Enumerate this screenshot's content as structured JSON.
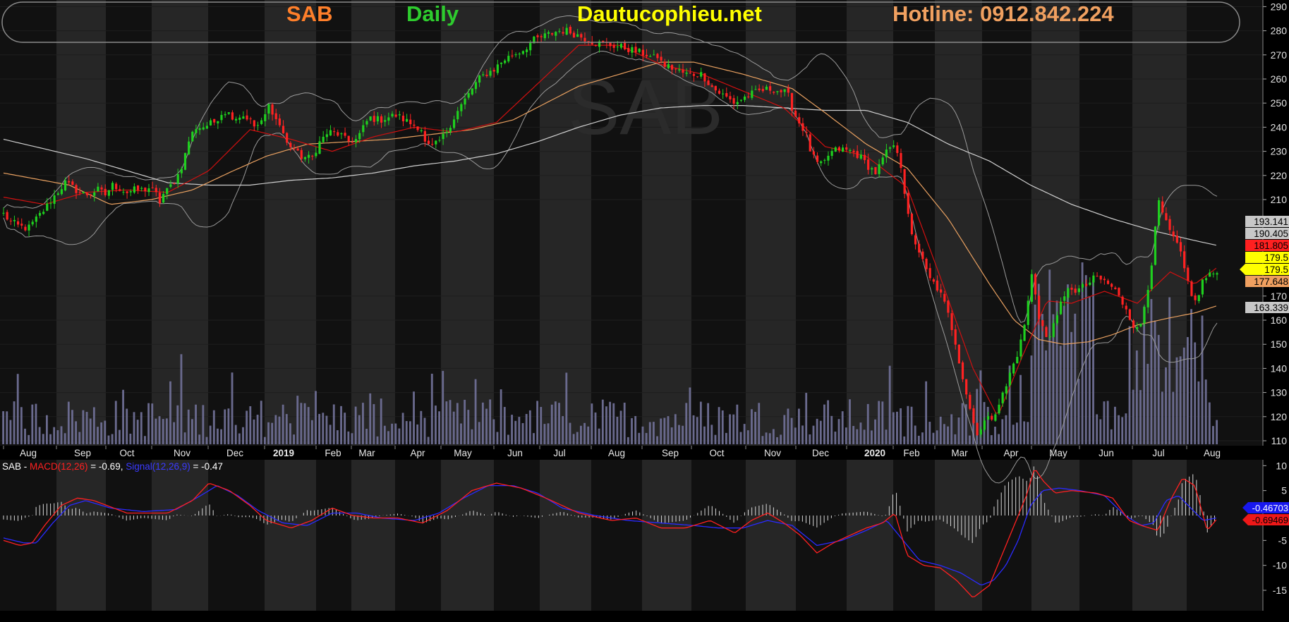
{
  "header": {
    "ticker": "SAB",
    "period": "Daily",
    "site": "Dautucophieu.net",
    "hotline": "Hotline: 0912.842.224",
    "watermark": "SAB"
  },
  "colors": {
    "background": "#000000",
    "panel": "#111111",
    "band_dark": "#161616",
    "band_light": "#262626",
    "candle_up": "#1fd01f",
    "candle_down": "#ff2222",
    "volume": "#6a6a8e",
    "ma_white": "#cfcfcf",
    "ma_orange": "#e8a060",
    "ma_red": "#d01010",
    "bollinger": "#9a9a9a",
    "macd_line": "#ff2020",
    "signal_line": "#2a2aff",
    "ticker_color": "#ff7f2a",
    "period_color": "#2ecc2e",
    "site_color": "#ffff00",
    "hotline_color": "#f0a060"
  },
  "chart_data": [
    {
      "type": "candlestick",
      "title": "SAB Daily",
      "ylim": [
        105,
        292
      ],
      "y_ticks": [
        290,
        280,
        270,
        260,
        250,
        240,
        230,
        220,
        210,
        170,
        160,
        150,
        140,
        130,
        120,
        110
      ],
      "x_labels": [
        "Aug",
        "Sep",
        "Oct",
        "Nov",
        "Dec",
        "2019",
        "Feb",
        "Mar",
        "Apr",
        "May",
        "Jun",
        "Jul",
        "Aug",
        "Sep",
        "Oct",
        "Nov",
        "Dec",
        "2020",
        "Feb",
        "Mar",
        "Apr",
        "May",
        "Jun",
        "Jul",
        "Aug"
      ],
      "bold_x_labels": [
        "2019",
        "2020"
      ],
      "price_path": {
        "x": [
          0,
          8,
          18,
          30,
          40,
          50,
          63,
          75,
          88,
          100,
          115,
          124,
          132,
          140,
          150,
          160,
          170,
          178,
          186,
          190,
          194,
          200,
          212,
          219,
          226,
          234,
          241,
          249,
          256,
          268,
          282,
          290,
          297,
          306,
          315,
          324,
          330,
          338,
          345,
          352,
          360,
          375,
          383,
          395,
          410,
          418,
          430,
          445,
          458,
          466,
          478,
          488,
          498,
          508,
          514,
          524,
          535,
          545,
          555,
          565,
          572,
          579,
          586,
          597,
          609,
          620,
          632,
          645,
          660,
          675,
          685,
          700,
          720,
          740,
          755,
          774,
          785,
          790,
          795,
          802,
          810,
          818,
          830,
          840,
          850,
          864,
          877,
          890,
          905,
          920,
          935,
          954,
          962,
          970,
          976,
          983,
          990,
          997,
          1005,
          1016,
          1032,
          1042,
          1052,
          1062,
          1072,
          1080,
          1089,
          1092,
          1096,
          1100,
          1105,
          1112,
          1120,
          1127,
          1133,
          1139,
          1145,
          1150,
          1158,
          1165,
          1173,
          1180,
          1186,
          1194,
          1204,
          1212,
          1220,
          1226,
          1232,
          1240,
          1246,
          1252,
          1260,
          1266,
          1272,
          1280,
          1290,
          1298,
          1306,
          1320,
          1330,
          1340,
          1352,
          1360,
          1367,
          1375,
          1382,
          1388,
          1394,
          1400,
          1405,
          1410,
          1415,
          1420,
          1426,
          1432,
          1438,
          1444,
          1452,
          1458,
          1466,
          1473,
          1477
        ],
        "close": [
          204,
          201,
          199,
          198,
          202,
          206,
          212,
          217,
          214,
          212,
          214,
          212,
          216,
          215,
          213,
          214,
          214,
          215,
          212,
          209,
          212,
          214,
          220,
          226,
          235,
          240,
          240,
          241,
          242,
          247,
          244,
          245,
          244,
          240,
          242,
          250,
          244,
          240,
          233,
          232,
          228,
          227,
          233,
          238,
          237,
          234,
          235,
          244,
          243,
          244,
          245,
          243,
          241,
          240,
          232,
          232,
          236,
          242,
          248,
          253,
          257,
          260,
          262,
          264,
          268,
          270,
          272,
          276,
          278,
          280,
          280,
          278,
          275,
          274,
          273,
          271,
          270,
          268,
          270,
          266,
          265,
          264,
          262,
          262,
          262,
          256,
          253,
          250,
          253,
          255,
          256,
          254,
          246,
          241,
          238,
          229,
          225,
          224,
          229,
          231,
          230,
          228,
          224,
          221,
          228,
          232,
          230,
          225,
          215,
          205,
          195,
          191,
          183,
          177,
          175,
          172,
          167,
          162,
          152,
          140,
          128,
          118,
          113,
          118,
          120,
          126,
          132,
          139,
          144,
          153,
          165,
          180,
          162,
          156,
          150,
          162,
          168,
          174,
          172,
          175,
          178,
          176,
          173,
          168,
          165,
          158,
          155,
          165,
          176,
          190,
          210,
          205,
          200,
          196,
          193,
          188,
          180,
          173,
          166,
          176,
          178,
          179.5
        ]
      },
      "moving_averages": [
        {
          "color": "white",
          "x": [
            0,
            50,
            100,
            150,
            200,
            250,
            300,
            350,
            400,
            450,
            500,
            550,
            600,
            650,
            700,
            750,
            800,
            850,
            900,
            950,
            1000,
            1050,
            1100,
            1150,
            1200,
            1250,
            1300,
            1350,
            1400,
            1450,
            1477
          ],
          "y": [
            235,
            231,
            227,
            222,
            217,
            216,
            216,
            218,
            219,
            221,
            224,
            226,
            229,
            234,
            240,
            245,
            248,
            249,
            249,
            248,
            247,
            247,
            242,
            233,
            226,
            216,
            208,
            202,
            197,
            193,
            191
          ]
        },
        {
          "color": "orange",
          "x": [
            0,
            80,
            130,
            180,
            230,
            280,
            320,
            370,
            420,
            470,
            520,
            570,
            620,
            660,
            700,
            750,
            800,
            840,
            900,
            960,
            1000,
            1050,
            1100,
            1150,
            1200,
            1230,
            1260,
            1290,
            1320,
            1350,
            1380,
            1420,
            1450,
            1477
          ],
          "y": [
            221,
            216,
            208,
            210,
            214,
            222,
            228,
            233,
            234,
            235,
            237,
            239,
            243,
            250,
            257,
            262,
            267,
            267,
            262,
            256,
            246,
            233,
            223,
            202,
            175,
            160,
            152,
            150,
            151,
            154,
            158,
            161,
            163,
            166
          ]
        },
        {
          "color": "red",
          "x": [
            0,
            50,
            100,
            150,
            200,
            250,
            300,
            350,
            400,
            450,
            500,
            550,
            600,
            650,
            700,
            750,
            800,
            850,
            900,
            950,
            1000,
            1050,
            1100,
            1140,
            1180,
            1210,
            1240,
            1270,
            1300,
            1340,
            1380,
            1420,
            1450,
            1477
          ],
          "y": [
            211,
            208,
            213,
            214,
            213,
            222,
            239,
            235,
            230,
            236,
            240,
            238,
            242,
            258,
            274,
            274,
            266,
            262,
            255,
            248,
            232,
            228,
            215,
            178,
            140,
            120,
            145,
            168,
            167,
            172,
            167,
            180,
            175,
            181.8
          ]
        }
      ],
      "price_labels": [
        {
          "text": "193.141",
          "bg": "#c8c8c8",
          "fg": "#000000"
        },
        {
          "text": "190.405",
          "bg": "#c8c8c8",
          "fg": "#000000"
        },
        {
          "text": "181.805",
          "bg": "#ff2020",
          "fg": "#000000"
        },
        {
          "text": "179.5",
          "bg": "#ffff00",
          "fg": "#000000"
        },
        {
          "text": "179.5",
          "bg": "#ffff00",
          "fg": "#000000"
        },
        {
          "text": "177.648",
          "bg": "#f0a060",
          "fg": "#000000"
        },
        {
          "text": "163.339",
          "bg": "#c8c8c8",
          "fg": "#000000"
        }
      ]
    },
    {
      "type": "line",
      "title": "SAB - MACD(12,26) = -0.69, Signal(12,26,9) = -0.47",
      "legend_prefix": "SAB - ",
      "legend_macd": "MACD(12,26)",
      "legend_macd_val": " = -0.69, ",
      "legend_signal": "Signal(12,26,9)",
      "legend_signal_val": " = -0.47",
      "ylim": [
        -18,
        12
      ],
      "y_ticks": [
        10,
        5,
        0,
        -5,
        -10,
        -15
      ],
      "y_tick_labels": [
        "10",
        "5",
        "",
        "-5",
        "-10",
        "-15"
      ],
      "series": [
        {
          "name": "MACD(12,26)",
          "color": "red",
          "x": [
            0,
            20,
            35,
            50,
            70,
            90,
            110,
            150,
            200,
            230,
            250,
            275,
            300,
            320,
            350,
            375,
            400,
            425,
            450,
            480,
            510,
            540,
            570,
            600,
            630,
            660,
            700,
            740,
            770,
            800,
            830,
            860,
            890,
            910,
            930,
            950,
            970,
            990,
            1010,
            1030,
            1050,
            1070,
            1085,
            1100,
            1120,
            1140,
            1160,
            1180,
            1200,
            1210,
            1220,
            1235,
            1245,
            1255,
            1265,
            1280,
            1300,
            1330,
            1350,
            1370,
            1385,
            1395,
            1405,
            1420,
            1435,
            1450,
            1465,
            1477
          ],
          "y": [
            -5,
            -6,
            -5.5,
            -2,
            2,
            3.5,
            3,
            0.5,
            0.5,
            3,
            6.5,
            5,
            2,
            -1,
            -2.5,
            -1,
            1.5,
            0,
            -0.5,
            -0.5,
            -1.5,
            1,
            5,
            6.5,
            5.5,
            3.5,
            0.5,
            -1,
            -0.5,
            -2.5,
            -2.5,
            -1,
            -3.5,
            -1,
            0.5,
            -1.5,
            -4,
            -7.5,
            -5.5,
            -4,
            -2.5,
            -1.5,
            0.5,
            -8,
            -10,
            -10.5,
            -13,
            -16.5,
            -14,
            -10,
            -6,
            0,
            4,
            9.5,
            7,
            4.5,
            5,
            4.5,
            3.5,
            -1,
            -2,
            -2.5,
            -3,
            3,
            7.5,
            6,
            -3,
            -0.69
          ]
        },
        {
          "name": "Signal(12,26,9)",
          "color": "blue",
          "x": [
            0,
            25,
            40,
            60,
            80,
            100,
            130,
            170,
            210,
            240,
            260,
            285,
            310,
            340,
            370,
            400,
            430,
            460,
            500,
            530,
            560,
            590,
            620,
            650,
            680,
            720,
            760,
            800,
            840,
            870,
            900,
            930,
            960,
            990,
            1020,
            1050,
            1075,
            1095,
            1115,
            1140,
            1165,
            1190,
            1205,
            1220,
            1235,
            1250,
            1265,
            1285,
            1310,
            1340,
            1365,
            1385,
            1400,
            1415,
            1430,
            1445,
            1460,
            1477
          ],
          "y": [
            -4.5,
            -5.5,
            -5.5,
            -1.5,
            2,
            3,
            1.5,
            0.8,
            1.2,
            4,
            6,
            4,
            1,
            -1.5,
            -2,
            0.5,
            0.5,
            -0.5,
            -1,
            0.5,
            3.5,
            6,
            6,
            4.5,
            1.5,
            0,
            -1,
            -1.5,
            -2,
            -2.5,
            -2.5,
            -1,
            -2,
            -6,
            -5,
            -3,
            -1,
            -5,
            -9,
            -10,
            -11.5,
            -14,
            -13,
            -10,
            -5,
            2,
            5,
            5.5,
            5,
            4,
            0,
            -2,
            -1.5,
            3,
            4,
            1.5,
            -1,
            -0.47
          ]
        }
      ],
      "value_labels": [
        {
          "text": "-0.46703",
          "bg": "#1818ee",
          "fg": "#ffffff"
        },
        {
          "text": "-0.69469",
          "bg": "#ee1818",
          "fg": "#000000"
        }
      ]
    }
  ]
}
